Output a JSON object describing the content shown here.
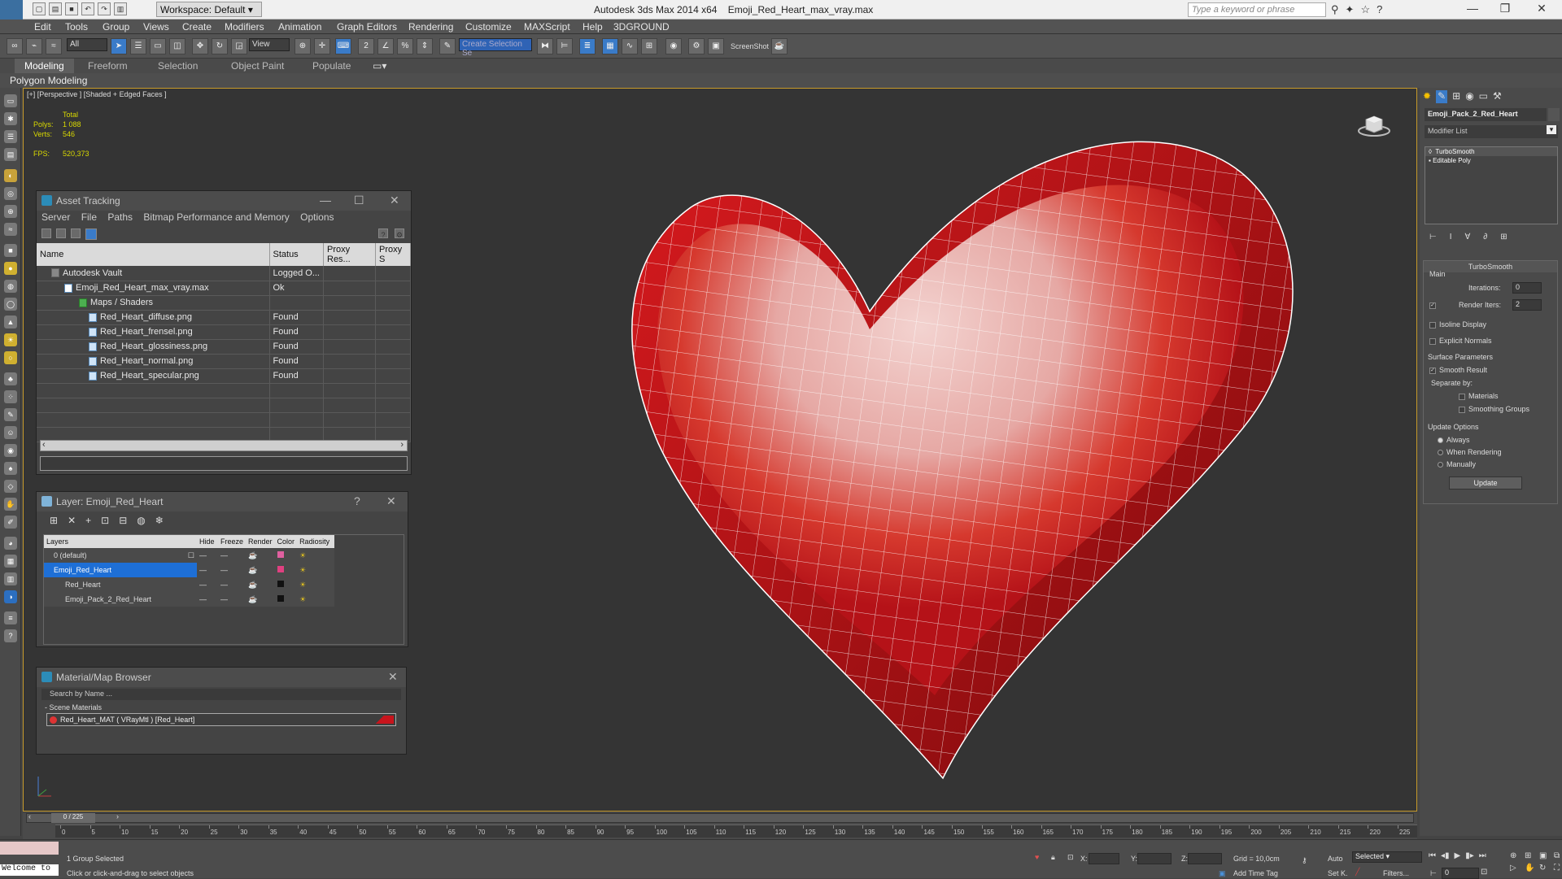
{
  "titlebar": {
    "app_title": "Autodesk 3ds Max  2014 x64",
    "file_name": "Emoji_Red_Heart_max_vray.max",
    "workspace": "Workspace: Default",
    "search_placeholder": "Type a keyword or phrase"
  },
  "menu": [
    "Edit",
    "Tools",
    "Group",
    "Views",
    "Create",
    "Modifiers",
    "Animation",
    "Graph Editors",
    "Rendering",
    "Customize",
    "MAXScript",
    "Help",
    "3DGROUND"
  ],
  "toolbar": {
    "selection_filter": "All",
    "ref_coord": "View",
    "named_selection": "Create Selection Se",
    "screenshot_label": "ScreenShot"
  },
  "ribbon": {
    "tabs": [
      "Modeling",
      "Freeform",
      "Selection",
      "Object Paint",
      "Populate"
    ],
    "active_tab": "Modeling",
    "sub_label": "Polygon Modeling"
  },
  "viewport": {
    "label": "[+] [Perspective ] [Shaded + Edged Faces ]",
    "stats_total": "Total",
    "polys_label": "Polys:",
    "polys_value": "1 088",
    "verts_label": "Verts:",
    "verts_value": "546",
    "fps_label": "FPS:",
    "fps_value": "520,373",
    "heart_color": "#c8141c"
  },
  "asset_tracking": {
    "title": "Asset Tracking",
    "menu": [
      "Server",
      "File",
      "Paths",
      "Bitmap Performance and Memory",
      "Options"
    ],
    "columns": [
      "Name",
      "Status",
      "Proxy Res...",
      "Proxy S"
    ],
    "rows": [
      {
        "name": "Autodesk Vault",
        "status": "Logged O..."
      },
      {
        "name": "Emoji_Red_Heart_max_vray.max",
        "status": "Ok"
      },
      {
        "name": "Maps / Shaders",
        "status": ""
      },
      {
        "name": "Red_Heart_diffuse.png",
        "status": "Found"
      },
      {
        "name": "Red_Heart_frensel.png",
        "status": "Found"
      },
      {
        "name": "Red_Heart_glossiness.png",
        "status": "Found"
      },
      {
        "name": "Red_Heart_normal.png",
        "status": "Found"
      },
      {
        "name": "Red_Heart_specular.png",
        "status": "Found"
      }
    ]
  },
  "layer_panel": {
    "title": "Layer: Emoji_Red_Heart",
    "columns": [
      "Layers",
      "Hide",
      "Freeze",
      "Render",
      "Color",
      "Radiosity"
    ],
    "rows": [
      {
        "name": "0 (default)",
        "color": "#e060a0"
      },
      {
        "name": "Emoji_Red_Heart",
        "color": "#e04080"
      },
      {
        "name": "Red_Heart",
        "color": "#111111"
      },
      {
        "name": "Emoji_Pack_2_Red_Heart",
        "color": "#111111"
      }
    ]
  },
  "material_browser": {
    "title": "Material/Map Browser",
    "search_placeholder": "Search by Name ...",
    "section": "- Scene Materials",
    "material": "Red_Heart_MAT  ( VRayMtl )  [Red_Heart]"
  },
  "command_panel": {
    "object_name": "Emoji_Pack_2_Red_Heart",
    "modifier_list": "Modifier List",
    "stack": [
      "TurboSmooth",
      "Editable Poly"
    ],
    "rollout_title": "TurboSmooth",
    "main_label": "Main",
    "iterations_label": "Iterations:",
    "iterations_value": "0",
    "render_iters_label": "Render Iters:",
    "render_iters_value": "2",
    "isoline": "Isoline Display",
    "explicit_normals": "Explicit Normals",
    "surface_params": "Surface Parameters",
    "smooth_result": "Smooth Result",
    "separate_by": "Separate by:",
    "materials": "Materials",
    "smoothing_groups": "Smoothing Groups",
    "update_options": "Update Options",
    "always": "Always",
    "when_rendering": "When Rendering",
    "manually": "Manually",
    "update_button": "Update"
  },
  "timeline": {
    "frame_counter": "0 / 225",
    "ticks": [
      "0",
      "5",
      "10",
      "15",
      "20",
      "25",
      "30",
      "35",
      "40",
      "45",
      "50",
      "55",
      "60",
      "65",
      "70",
      "75",
      "80",
      "85",
      "90",
      "95",
      "100",
      "105",
      "110",
      "115",
      "120",
      "125",
      "130",
      "135",
      "140",
      "145",
      "150",
      "155",
      "160",
      "165",
      "170",
      "175",
      "180",
      "185",
      "190",
      "195",
      "200",
      "205",
      "210",
      "215",
      "220",
      "225"
    ]
  },
  "status": {
    "script_box": "Welcome to",
    "selected": "1 Group Selected",
    "hint": "Click or click-and-drag to select objects",
    "x_label": "X:",
    "y_label": "Y:",
    "z_label": "Z:",
    "grid": "Grid = 10,0cm",
    "add_time_tag": "Add Time Tag",
    "auto": "Auto",
    "set_k": "Set K.",
    "selected_dropdown": "Selected",
    "filters": "Filters...",
    "frame": "0"
  }
}
